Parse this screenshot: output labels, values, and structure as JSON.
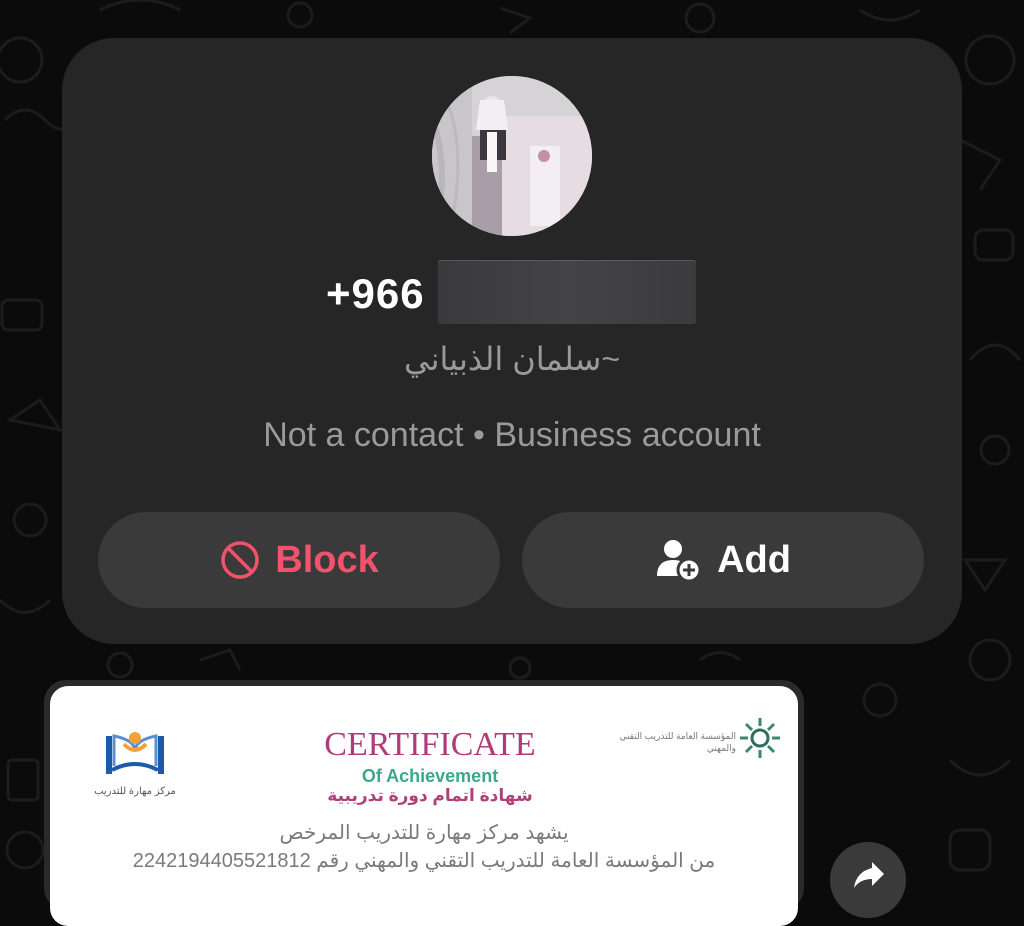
{
  "profile": {
    "phone_prefix": "+966",
    "alias": "~سلمان الذبياني",
    "status": "Not a contact • Business account"
  },
  "actions": {
    "block_label": "Block",
    "add_label": "Add"
  },
  "certificate": {
    "title": "CERTIFICATE",
    "subtitle": "Of Achievement",
    "subtitle_ar": "شهادة اتمام دورة تدريبية",
    "line1": "يشهد مركز مهارة للتدريب المرخص",
    "line2": "من المؤسسة العامة للتدريب التقني والمهني رقم 2242194405521812",
    "left_logo_caption": "مركز مهارة للتدريب",
    "right_logo_caption": "المؤسسة العامة للتدريب التقني والمهني"
  },
  "colors": {
    "block": "#f0536b",
    "card": "#262626",
    "button": "#3a3a3a",
    "muted_text": "#9a9a9a"
  },
  "icons": {
    "block": "block-icon",
    "add": "add-contact-icon",
    "share": "share-forward-icon"
  }
}
